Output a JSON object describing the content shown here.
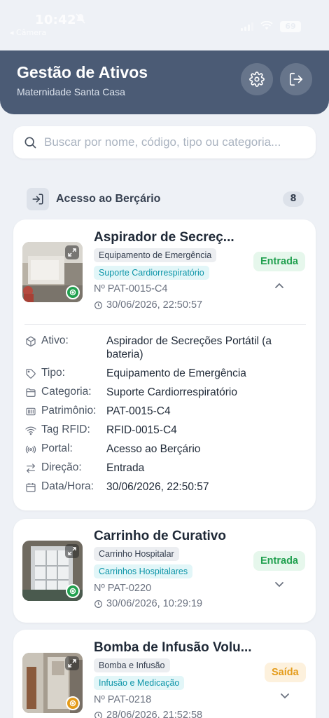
{
  "status_bar": {
    "time": "10:42",
    "back_label": "◂ Câmera",
    "battery": "69"
  },
  "header": {
    "title": "Gestão de Ativos",
    "subtitle": "Maternidade Santa Casa"
  },
  "search": {
    "placeholder": "Buscar por nome, código, tipo ou categoria..."
  },
  "section": {
    "title": "Acesso ao Berçário",
    "count": "8"
  },
  "colors": {
    "header_bg": "#4b5b75",
    "entrada": "#21a04f",
    "saida": "#e49b1a",
    "category": "#0d95a8"
  },
  "cards": [
    {
      "title": "Aspirador de Secreç...",
      "type": "Equipamento de Emergência",
      "category": "Suporte Cardiorrespiratório",
      "code": "Nº PAT-0015-C4",
      "datetime": "30/06/2026, 22:50:57",
      "direction": "Entrada",
      "expanded": true,
      "details": [
        {
          "icon": "cube-icon",
          "label": "Ativo:",
          "value": "Aspirador de Secreções Portátil (a bateria)"
        },
        {
          "icon": "tag-icon",
          "label": "Tipo:",
          "value": "Equipamento de Emergência"
        },
        {
          "icon": "folder-icon",
          "label": "Categoria:",
          "value": "Suporte Cardiorrespiratório"
        },
        {
          "icon": "barcode-icon",
          "label": "Patrimônio:",
          "value": "PAT-0015-C4"
        },
        {
          "icon": "wifi-icon",
          "label": "Tag RFID:",
          "value": "RFID-0015-C4"
        },
        {
          "icon": "broadcast-icon",
          "label": "Portal:",
          "value": "Acesso ao Berçário"
        },
        {
          "icon": "arrows-icon",
          "label": "Direção:",
          "value": "Entrada"
        },
        {
          "icon": "calendar-icon",
          "label": "Data/Hora:",
          "value": "30/06/2026, 22:50:57"
        }
      ]
    },
    {
      "title": "Carrinho de Curativo",
      "type": "Carrinho Hospitalar",
      "category": "Carrinhos Hospitalares",
      "code": "Nº PAT-0220",
      "datetime": "30/06/2026, 10:29:19",
      "direction": "Entrada",
      "expanded": false
    },
    {
      "title": "Bomba de Infusão Volu...",
      "type": "Bomba e Infusão",
      "category": "Infusão e Medicação",
      "code": "Nº PAT-0218",
      "datetime": "28/06/2026, 21:52:58",
      "direction": "Saída",
      "expanded": false
    }
  ]
}
